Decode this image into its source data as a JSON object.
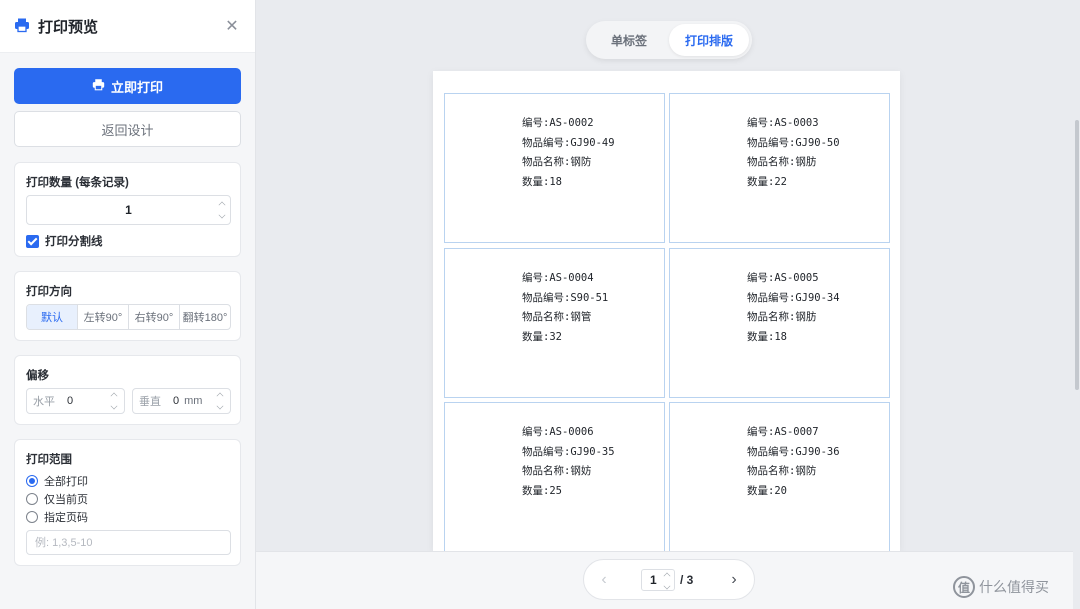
{
  "header": {
    "title": "打印预览"
  },
  "actions": {
    "print_now": "立即打印",
    "back_design": "返回设计"
  },
  "quantity": {
    "label": "打印数量 (每条记录)",
    "value": "1",
    "divider_label": "打印分割线",
    "divider_checked": true
  },
  "direction": {
    "label": "打印方向",
    "options": [
      "默认",
      "左转90°",
      "右转90°",
      "翻转180°"
    ],
    "selected": 0
  },
  "offset": {
    "label": "偏移",
    "horizontal_label": "水平",
    "horizontal_value": "0",
    "vertical_label": "垂直",
    "vertical_value": "0",
    "unit": "mm"
  },
  "range": {
    "label": "打印范围",
    "options": [
      "全部打印",
      "仅当前页",
      "指定页码"
    ],
    "selected": 0,
    "placeholder": "例: 1,3,5-10"
  },
  "tabs": [
    "单标签",
    "打印排版"
  ],
  "active_tab": 1,
  "labels": [
    {
      "code": "编号:AS-0002",
      "item_code": "物品编号:GJ90-49",
      "item_name": "物品名称:钢防",
      "qty": "数量:18"
    },
    {
      "code": "编号:AS-0003",
      "item_code": "物品编号:GJ90-50",
      "item_name": "物品名称:钢肪",
      "qty": "数量:22"
    },
    {
      "code": "编号:AS-0004",
      "item_code": "物品编号:S90-51",
      "item_name": "物品名称:钢管",
      "qty": "数量:32"
    },
    {
      "code": "编号:AS-0005",
      "item_code": "物品编号:GJ90-34",
      "item_name": "物品名称:钢肪",
      "qty": "数量:18"
    },
    {
      "code": "编号:AS-0006",
      "item_code": "物品编号:GJ90-35",
      "item_name": "物品名称:钢妨",
      "qty": "数量:25"
    },
    {
      "code": "编号:AS-0007",
      "item_code": "物品编号:GJ90-36",
      "item_name": "物品名称:钢防",
      "qty": "数量:20"
    }
  ],
  "pager": {
    "current": "1",
    "total": "/ 3"
  },
  "watermark": {
    "logo": "值",
    "text": "什么值得买"
  },
  "icons": {
    "header": "printer-icon",
    "close": "close-icon",
    "print_button": "printer-icon"
  },
  "colors": {
    "accent": "#2a6af0",
    "label_border": "#b9d3f0"
  }
}
